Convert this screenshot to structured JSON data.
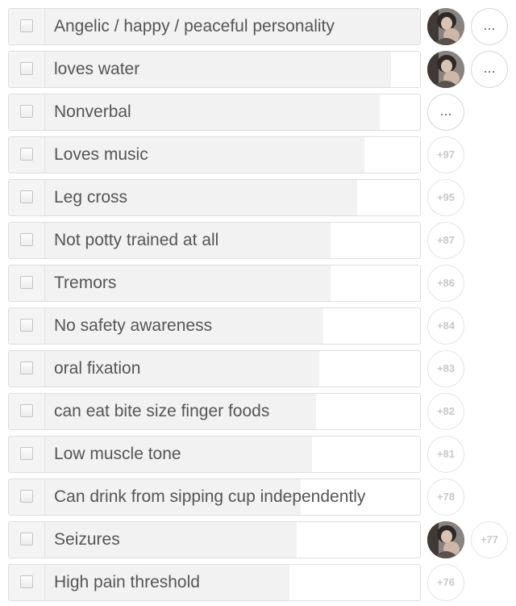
{
  "items": [
    {
      "label": "Angelic / happy / peaceful personality",
      "bar": 1.0,
      "avatar": true,
      "action": "..."
    },
    {
      "label": "loves water",
      "bar": 0.92,
      "avatar": true,
      "action": "..."
    },
    {
      "label": "Nonverbal",
      "bar": 0.89,
      "avatar": false,
      "action": "..."
    },
    {
      "label": "Loves music",
      "bar": 0.85,
      "avatar": false,
      "action": "+97"
    },
    {
      "label": "Leg cross",
      "bar": 0.83,
      "avatar": false,
      "action": "+95"
    },
    {
      "label": "Not potty trained at all",
      "bar": 0.76,
      "avatar": false,
      "action": "+87"
    },
    {
      "label": "Tremors",
      "bar": 0.76,
      "avatar": false,
      "action": "+86"
    },
    {
      "label": "No safety awareness",
      "bar": 0.74,
      "avatar": false,
      "action": "+84"
    },
    {
      "label": "oral fixation",
      "bar": 0.73,
      "avatar": false,
      "action": "+83"
    },
    {
      "label": "can eat bite size finger foods",
      "bar": 0.72,
      "avatar": false,
      "action": "+82"
    },
    {
      "label": "Low muscle tone",
      "bar": 0.71,
      "avatar": false,
      "action": "+81"
    },
    {
      "label": "Can drink from sipping cup independently",
      "bar": 0.68,
      "avatar": false,
      "action": "+78"
    },
    {
      "label": "Seizures",
      "bar": 0.67,
      "avatar": true,
      "action": "+77"
    },
    {
      "label": "High pain threshold",
      "bar": 0.65,
      "avatar": false,
      "action": "+76"
    }
  ],
  "icons": {
    "checkbox": "checkbox-icon",
    "avatar": "user-avatar"
  }
}
